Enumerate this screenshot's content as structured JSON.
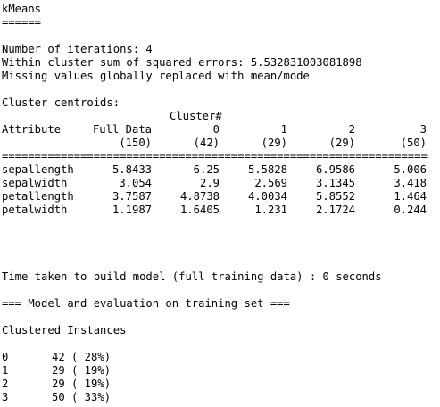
{
  "header": {
    "title": "kMeans",
    "underline": "======"
  },
  "summary": {
    "iterations": "Number of iterations: 4",
    "sse": "Within cluster sum of squared errors: 5.532831003081898",
    "missing": "Missing values globally replaced with mean/mode"
  },
  "centroids": {
    "heading": "Cluster centroids:",
    "cluster_label": "Cluster#",
    "attribute_label": "Attribute",
    "columns": [
      "Full Data",
      "0",
      "1",
      "2",
      "3"
    ],
    "counts": [
      "(150)",
      "(42)",
      "(29)",
      "(29)",
      "(50)"
    ],
    "separator": "=====================================================================",
    "rows": [
      {
        "name": "sepallength",
        "values": [
          "5.8433",
          "6.25",
          "5.5828",
          "6.9586",
          "5.006"
        ]
      },
      {
        "name": "sepalwidth",
        "values": [
          "3.054",
          "2.9",
          "2.569",
          "3.1345",
          "3.418"
        ]
      },
      {
        "name": "petallength",
        "values": [
          "3.7587",
          "4.8738",
          "4.0034",
          "5.8552",
          "1.464"
        ]
      },
      {
        "name": "petalwidth",
        "values": [
          "1.1987",
          "1.6405",
          "1.231",
          "2.1724",
          "0.244"
        ]
      }
    ]
  },
  "timing": "Time taken to build model (full training data) : 0 seconds",
  "evaluation": "=== Model and evaluation on training set ===",
  "clustered": {
    "heading": "Clustered Instances",
    "rows": [
      {
        "cluster": "0",
        "info": "42 ( 28%)"
      },
      {
        "cluster": "1",
        "info": "29 ( 19%)"
      },
      {
        "cluster": "2",
        "info": "29 ( 19%)"
      },
      {
        "cluster": "3",
        "info": "50 ( 33%)"
      }
    ]
  }
}
